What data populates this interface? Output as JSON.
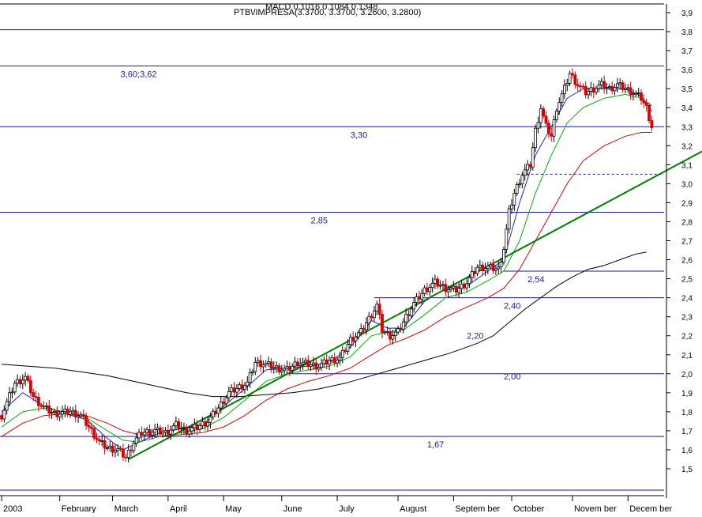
{
  "chart_data": {
    "type": "candlestick",
    "title": "PTB\\/IMPRESA(3.3700, 3.3700, 3.2600, 3.2800)",
    "overlapped_header": "MACD 0.1016 0.1084 0.1348",
    "ylim": [
      1.4,
      3.95
    ],
    "y_ticks": [
      "3,9",
      "3,8",
      "3,7",
      "3,6",
      "3,5",
      "3,4",
      "3,3",
      "3,2",
      "3,1",
      "3,0",
      "2,9",
      "2,8",
      "2,7",
      "2,6",
      "2,5",
      "2,4",
      "2,3",
      "2,2",
      "2,1",
      "2,0",
      "1,9",
      "1,8",
      "1,7",
      "1,6",
      "1,5"
    ],
    "y_tick_values": [
      3.9,
      3.8,
      3.7,
      3.6,
      3.5,
      3.4,
      3.3,
      3.2,
      3.1,
      3.0,
      2.9,
      2.8,
      2.7,
      2.6,
      2.5,
      2.4,
      2.3,
      2.2,
      2.1,
      2.0,
      1.9,
      1.8,
      1.7,
      1.6,
      1.5
    ],
    "x_ticks": [
      {
        "label": "2003",
        "day": 0
      },
      {
        "label": "February",
        "day": 22
      },
      {
        "label": "March",
        "day": 42
      },
      {
        "label": "April",
        "day": 63
      },
      {
        "label": "May",
        "day": 84
      },
      {
        "label": "June",
        "day": 106
      },
      {
        "label": "July",
        "day": 127
      },
      {
        "label": "August",
        "day": 150
      },
      {
        "label": "Septem ber",
        "day": 171
      },
      {
        "label": "October",
        "day": 193
      },
      {
        "label": "Novem ber",
        "day": 216
      },
      {
        "label": "Decem ber",
        "day": 237
      }
    ],
    "levels": [
      {
        "value": 3.81,
        "label": "",
        "style": "solid"
      },
      {
        "value": 3.62,
        "label": "3,60;3,62",
        "label_day": 45,
        "style": "solid"
      },
      {
        "value": 3.3,
        "label": "3,30",
        "label_day": 132,
        "style": "solid"
      },
      {
        "value": 3.05,
        "label": "",
        "style": "dashed",
        "from_day": 195
      },
      {
        "value": 2.85,
        "label": "2,85",
        "label_day": 117,
        "style": "solid"
      },
      {
        "value": 2.54,
        "label": "2,54",
        "label_day": 199,
        "from_day": 190,
        "style": "solid"
      },
      {
        "value": 2.4,
        "label": "2,40",
        "label_day": 190,
        "from_day": 141,
        "style": "solid"
      },
      {
        "value": 2.2,
        "label": "2,20",
        "label_day": 176,
        "style": "none"
      },
      {
        "value": 2.0,
        "label": "2,00",
        "label_day": 190,
        "from_day": 108,
        "style": "solid"
      },
      {
        "value": 1.67,
        "label": "1,67",
        "label_day": 161,
        "style": "solid"
      }
    ],
    "trendline": {
      "from": {
        "day": 48,
        "value": 1.55
      },
      "to": {
        "day": 265,
        "value": 3.17
      }
    },
    "price": [
      {
        "day": 0,
        "value": 1.78
      },
      {
        "day": 5,
        "value": 1.95
      },
      {
        "day": 9,
        "value": 1.98
      },
      {
        "day": 12,
        "value": 1.88
      },
      {
        "day": 16,
        "value": 1.82
      },
      {
        "day": 20,
        "value": 1.79
      },
      {
        "day": 26,
        "value": 1.8
      },
      {
        "day": 30,
        "value": 1.78
      },
      {
        "day": 34,
        "value": 1.7
      },
      {
        "day": 37,
        "value": 1.64
      },
      {
        "day": 40,
        "value": 1.61
      },
      {
        "day": 44,
        "value": 1.6
      },
      {
        "day": 47,
        "value": 1.56
      },
      {
        "day": 50,
        "value": 1.64
      },
      {
        "day": 53,
        "value": 1.69
      },
      {
        "day": 58,
        "value": 1.7
      },
      {
        "day": 62,
        "value": 1.69
      },
      {
        "day": 66,
        "value": 1.73
      },
      {
        "day": 70,
        "value": 1.7
      },
      {
        "day": 74,
        "value": 1.72
      },
      {
        "day": 78,
        "value": 1.75
      },
      {
        "day": 82,
        "value": 1.82
      },
      {
        "day": 86,
        "value": 1.9
      },
      {
        "day": 90,
        "value": 1.93
      },
      {
        "day": 93,
        "value": 1.95
      },
      {
        "day": 96,
        "value": 2.06
      },
      {
        "day": 100,
        "value": 2.05
      },
      {
        "day": 104,
        "value": 2.03
      },
      {
        "day": 108,
        "value": 2.02
      },
      {
        "day": 112,
        "value": 2.06
      },
      {
        "day": 116,
        "value": 2.05
      },
      {
        "day": 120,
        "value": 2.04
      },
      {
        "day": 124,
        "value": 2.07
      },
      {
        "day": 128,
        "value": 2.08
      },
      {
        "day": 132,
        "value": 2.18
      },
      {
        "day": 136,
        "value": 2.22
      },
      {
        "day": 139,
        "value": 2.29
      },
      {
        "day": 142,
        "value": 2.36
      },
      {
        "day": 144,
        "value": 2.23
      },
      {
        "day": 147,
        "value": 2.2
      },
      {
        "day": 150,
        "value": 2.22
      },
      {
        "day": 153,
        "value": 2.3
      },
      {
        "day": 156,
        "value": 2.37
      },
      {
        "day": 160,
        "value": 2.44
      },
      {
        "day": 164,
        "value": 2.48
      },
      {
        "day": 168,
        "value": 2.45
      },
      {
        "day": 172,
        "value": 2.44
      },
      {
        "day": 176,
        "value": 2.48
      },
      {
        "day": 180,
        "value": 2.56
      },
      {
        "day": 184,
        "value": 2.56
      },
      {
        "day": 188,
        "value": 2.55
      },
      {
        "day": 190,
        "value": 2.66
      },
      {
        "day": 192,
        "value": 2.85
      },
      {
        "day": 194,
        "value": 2.95
      },
      {
        "day": 197,
        "value": 3.05
      },
      {
        "day": 200,
        "value": 3.1
      },
      {
        "day": 202,
        "value": 3.28
      },
      {
        "day": 204,
        "value": 3.4
      },
      {
        "day": 206,
        "value": 3.3
      },
      {
        "day": 208,
        "value": 3.25
      },
      {
        "day": 210,
        "value": 3.4
      },
      {
        "day": 213,
        "value": 3.5
      },
      {
        "day": 215,
        "value": 3.58
      },
      {
        "day": 218,
        "value": 3.52
      },
      {
        "day": 221,
        "value": 3.48
      },
      {
        "day": 224,
        "value": 3.5
      },
      {
        "day": 227,
        "value": 3.52
      },
      {
        "day": 230,
        "value": 3.5
      },
      {
        "day": 233,
        "value": 3.52
      },
      {
        "day": 236,
        "value": 3.5
      },
      {
        "day": 239,
        "value": 3.48
      },
      {
        "day": 242,
        "value": 3.45
      },
      {
        "day": 244,
        "value": 3.4
      },
      {
        "day": 246,
        "value": 3.3
      }
    ],
    "series": [
      {
        "color": "#1f1fd0",
        "points": [
          [
            0,
            1.8
          ],
          [
            8,
            1.9
          ],
          [
            16,
            1.83
          ],
          [
            24,
            1.79
          ],
          [
            32,
            1.76
          ],
          [
            40,
            1.66
          ],
          [
            46,
            1.6
          ],
          [
            52,
            1.64
          ],
          [
            60,
            1.69
          ],
          [
            68,
            1.71
          ],
          [
            76,
            1.73
          ],
          [
            84,
            1.83
          ],
          [
            92,
            1.92
          ],
          [
            100,
            2.02
          ],
          [
            108,
            2.03
          ],
          [
            116,
            2.04
          ],
          [
            124,
            2.06
          ],
          [
            132,
            2.14
          ],
          [
            140,
            2.28
          ],
          [
            146,
            2.24
          ],
          [
            152,
            2.24
          ],
          [
            160,
            2.38
          ],
          [
            168,
            2.45
          ],
          [
            176,
            2.46
          ],
          [
            184,
            2.54
          ],
          [
            190,
            2.6
          ],
          [
            196,
            2.9
          ],
          [
            202,
            3.15
          ],
          [
            208,
            3.3
          ],
          [
            214,
            3.45
          ],
          [
            220,
            3.5
          ],
          [
            228,
            3.5
          ],
          [
            236,
            3.5
          ],
          [
            242,
            3.46
          ],
          [
            246,
            3.38
          ]
        ]
      },
      {
        "color": "#00b000",
        "points": [
          [
            0,
            1.72
          ],
          [
            8,
            1.8
          ],
          [
            16,
            1.82
          ],
          [
            24,
            1.8
          ],
          [
            32,
            1.77
          ],
          [
            40,
            1.7
          ],
          [
            46,
            1.65
          ],
          [
            52,
            1.64
          ],
          [
            60,
            1.67
          ],
          [
            68,
            1.69
          ],
          [
            76,
            1.71
          ],
          [
            84,
            1.77
          ],
          [
            92,
            1.86
          ],
          [
            100,
            1.96
          ],
          [
            108,
            2.0
          ],
          [
            116,
            2.02
          ],
          [
            124,
            2.04
          ],
          [
            132,
            2.09
          ],
          [
            140,
            2.2
          ],
          [
            146,
            2.22
          ],
          [
            152,
            2.23
          ],
          [
            160,
            2.31
          ],
          [
            168,
            2.4
          ],
          [
            176,
            2.43
          ],
          [
            184,
            2.49
          ],
          [
            190,
            2.54
          ],
          [
            196,
            2.7
          ],
          [
            202,
            2.95
          ],
          [
            208,
            3.15
          ],
          [
            214,
            3.32
          ],
          [
            220,
            3.4
          ],
          [
            228,
            3.45
          ],
          [
            236,
            3.47
          ],
          [
            242,
            3.45
          ],
          [
            246,
            3.41
          ]
        ]
      },
      {
        "color": "#e00000",
        "points": [
          [
            0,
            1.67
          ],
          [
            8,
            1.74
          ],
          [
            16,
            1.78
          ],
          [
            24,
            1.79
          ],
          [
            32,
            1.78
          ],
          [
            40,
            1.74
          ],
          [
            46,
            1.7
          ],
          [
            52,
            1.68
          ],
          [
            60,
            1.67
          ],
          [
            68,
            1.68
          ],
          [
            76,
            1.69
          ],
          [
            84,
            1.72
          ],
          [
            92,
            1.78
          ],
          [
            100,
            1.86
          ],
          [
            108,
            1.92
          ],
          [
            116,
            1.96
          ],
          [
            124,
            1.99
          ],
          [
            132,
            2.03
          ],
          [
            140,
            2.1
          ],
          [
            146,
            2.15
          ],
          [
            152,
            2.18
          ],
          [
            160,
            2.23
          ],
          [
            168,
            2.3
          ],
          [
            176,
            2.35
          ],
          [
            184,
            2.4
          ],
          [
            190,
            2.45
          ],
          [
            196,
            2.55
          ],
          [
            202,
            2.7
          ],
          [
            208,
            2.85
          ],
          [
            214,
            3.0
          ],
          [
            220,
            3.12
          ],
          [
            228,
            3.2
          ],
          [
            236,
            3.25
          ],
          [
            242,
            3.27
          ],
          [
            246,
            3.27
          ]
        ]
      },
      {
        "color": "#000000",
        "points": [
          [
            0,
            2.05
          ],
          [
            10,
            2.04
          ],
          [
            20,
            2.03
          ],
          [
            30,
            2.01
          ],
          [
            40,
            1.99
          ],
          [
            50,
            1.96
          ],
          [
            60,
            1.93
          ],
          [
            70,
            1.9
          ],
          [
            80,
            1.88
          ],
          [
            90,
            1.88
          ],
          [
            100,
            1.89
          ],
          [
            110,
            1.9
          ],
          [
            120,
            1.92
          ],
          [
            130,
            1.95
          ],
          [
            140,
            1.99
          ],
          [
            150,
            2.03
          ],
          [
            160,
            2.07
          ],
          [
            170,
            2.11
          ],
          [
            180,
            2.16
          ],
          [
            186,
            2.2
          ],
          [
            192,
            2.27
          ],
          [
            198,
            2.34
          ],
          [
            204,
            2.4
          ],
          [
            210,
            2.46
          ],
          [
            216,
            2.51
          ],
          [
            222,
            2.55
          ],
          [
            228,
            2.57
          ],
          [
            234,
            2.6
          ],
          [
            240,
            2.63
          ],
          [
            244,
            2.64
          ]
        ]
      }
    ]
  }
}
